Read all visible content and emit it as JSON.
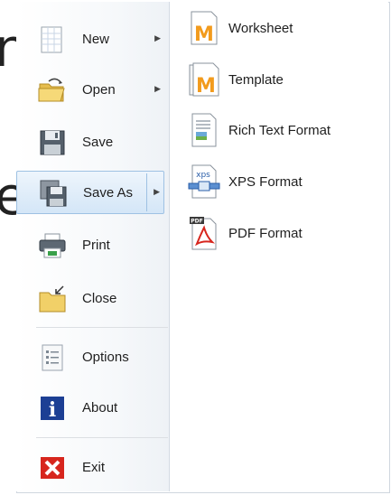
{
  "left_menu": {
    "new": {
      "label": "New",
      "icon": "new-document-icon"
    },
    "open": {
      "label": "Open",
      "icon": "open-folder-icon"
    },
    "save": {
      "label": "Save",
      "icon": "floppy-disk-icon"
    },
    "save_as": {
      "label": "Save As",
      "icon": "save-as-icon"
    },
    "print": {
      "label": "Print",
      "icon": "printer-icon"
    },
    "close": {
      "label": "Close",
      "icon": "close-folder-icon"
    },
    "options": {
      "label": "Options",
      "icon": "options-list-icon"
    },
    "about": {
      "label": "About",
      "icon": "info-icon"
    },
    "exit": {
      "label": "Exit",
      "icon": "exit-x-icon"
    }
  },
  "save_as_submenu": [
    {
      "label": "Worksheet",
      "icon": "worksheet-icon"
    },
    {
      "label": "Template",
      "icon": "template-icon"
    },
    {
      "label": "Rich Text Format",
      "icon": "rich-text-icon"
    },
    {
      "label": "XPS Format",
      "icon": "xps-icon"
    },
    {
      "label": "PDF Format",
      "icon": "pdf-icon"
    }
  ],
  "colors": {
    "selected_bg": "#d4e6f7",
    "selected_border": "#9ec1e3",
    "folder": "#f1d068",
    "about_blue": "#1c3f94",
    "exit_red": "#d7261e",
    "brand_orange": "#f29b1d"
  }
}
